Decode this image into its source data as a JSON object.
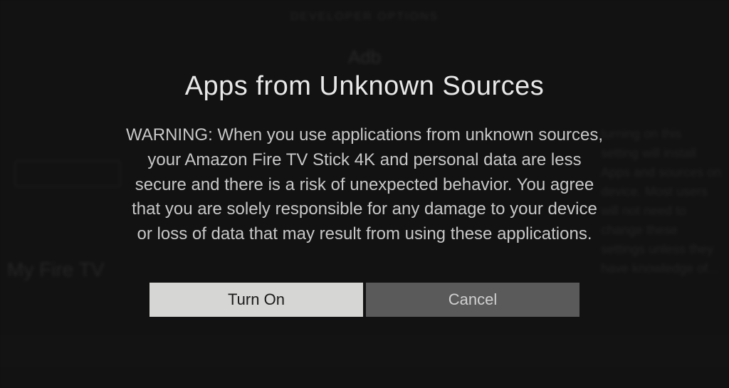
{
  "background": {
    "header": "DEVELOPER OPTIONS",
    "banner": "Adb",
    "my_fire_tv": "My Fire TV",
    "right_blur": "turning on this setting will install Apps and sources on device. Most users will not need to change these settings unless they have knowledge of..."
  },
  "dialog": {
    "title": "Apps from Unknown Sources",
    "body": "WARNING: When you use applications from unknown sources, your Amazon Fire TV Stick 4K and personal data are less secure and there is a risk of unexpected behavior. You agree that you are solely responsible for any damage to your device or loss of data that may result from using these applications.",
    "buttons": {
      "confirm": "Turn On",
      "cancel": "Cancel"
    }
  }
}
